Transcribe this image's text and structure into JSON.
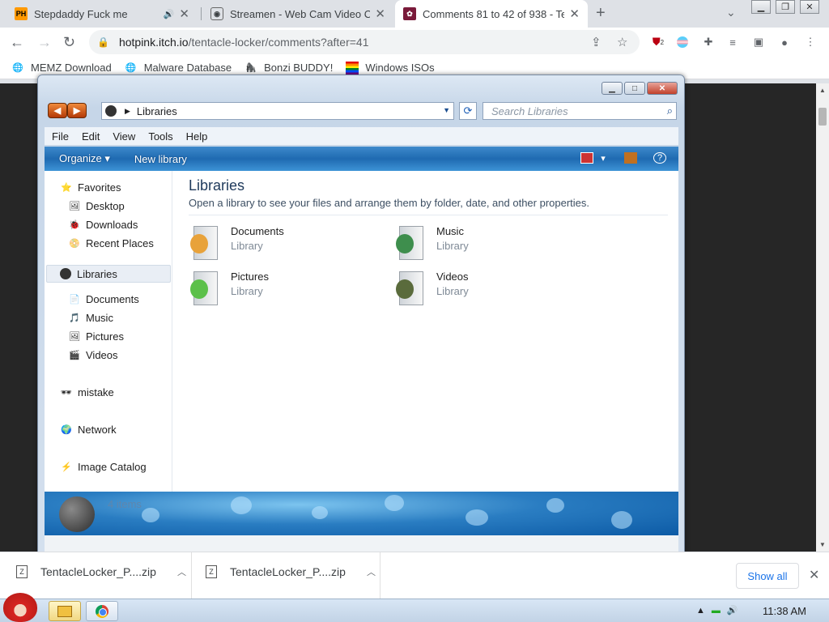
{
  "browser": {
    "tabs": [
      {
        "title": "Stepdaddy Fuck me",
        "favicon": "PH",
        "favicon_bg": "#f90",
        "audio": true,
        "active": false
      },
      {
        "title": "Streamen - Web Cam Video Ch",
        "favicon": "cam-icon",
        "active": false
      },
      {
        "title": "Comments 81 to 42 of 938 - Te",
        "favicon": "itch-icon",
        "active": true
      }
    ],
    "url_host": "hotpink.itch.io",
    "url_path": "/tentacle-locker/comments?after=41",
    "extension_badge": "2",
    "bookmarks": [
      {
        "label": "MEMZ Download",
        "icon": "globe-icon"
      },
      {
        "label": "Malware Database",
        "icon": "globe-icon"
      },
      {
        "label": "Bonzi BUDDY!",
        "icon": "bonzi-icon"
      },
      {
        "label": "Windows ISOs",
        "icon": "windows-flag-icon"
      }
    ]
  },
  "explorer": {
    "address": "Libraries",
    "search_placeholder": "Search Libraries",
    "menu": [
      "File",
      "Edit",
      "View",
      "Tools",
      "Help"
    ],
    "commands": [
      "Organize ▾",
      "New library"
    ],
    "nav": {
      "favorites": "Favorites",
      "favorites_items": [
        "Desktop",
        "Downloads",
        "Recent Places"
      ],
      "libraries": "Libraries",
      "libraries_items": [
        "Documents",
        "Music",
        "Pictures",
        "Videos"
      ],
      "mistake": "mistake",
      "network": "Network",
      "image_catalog": "Image Catalog"
    },
    "heading": "Libraries",
    "subheading": "Open a library to see your files and arrange them by folder, date, and other properties.",
    "libraries": [
      {
        "name": "Documents",
        "kind": "Library",
        "color": "#e8a23a"
      },
      {
        "name": "Music",
        "kind": "Library",
        "color": "#3e8e4d"
      },
      {
        "name": "Pictures",
        "kind": "Library",
        "color": "#5cc04a"
      },
      {
        "name": "Videos",
        "kind": "Library",
        "color": "#5a6b3c"
      }
    ],
    "item_count": "4 items"
  },
  "downloads": [
    {
      "filename": "TentacleLocker_P....zip"
    },
    {
      "filename": "TentacleLocker_P....zip"
    }
  ],
  "show_all": "Show all",
  "clock": "11:38 AM"
}
